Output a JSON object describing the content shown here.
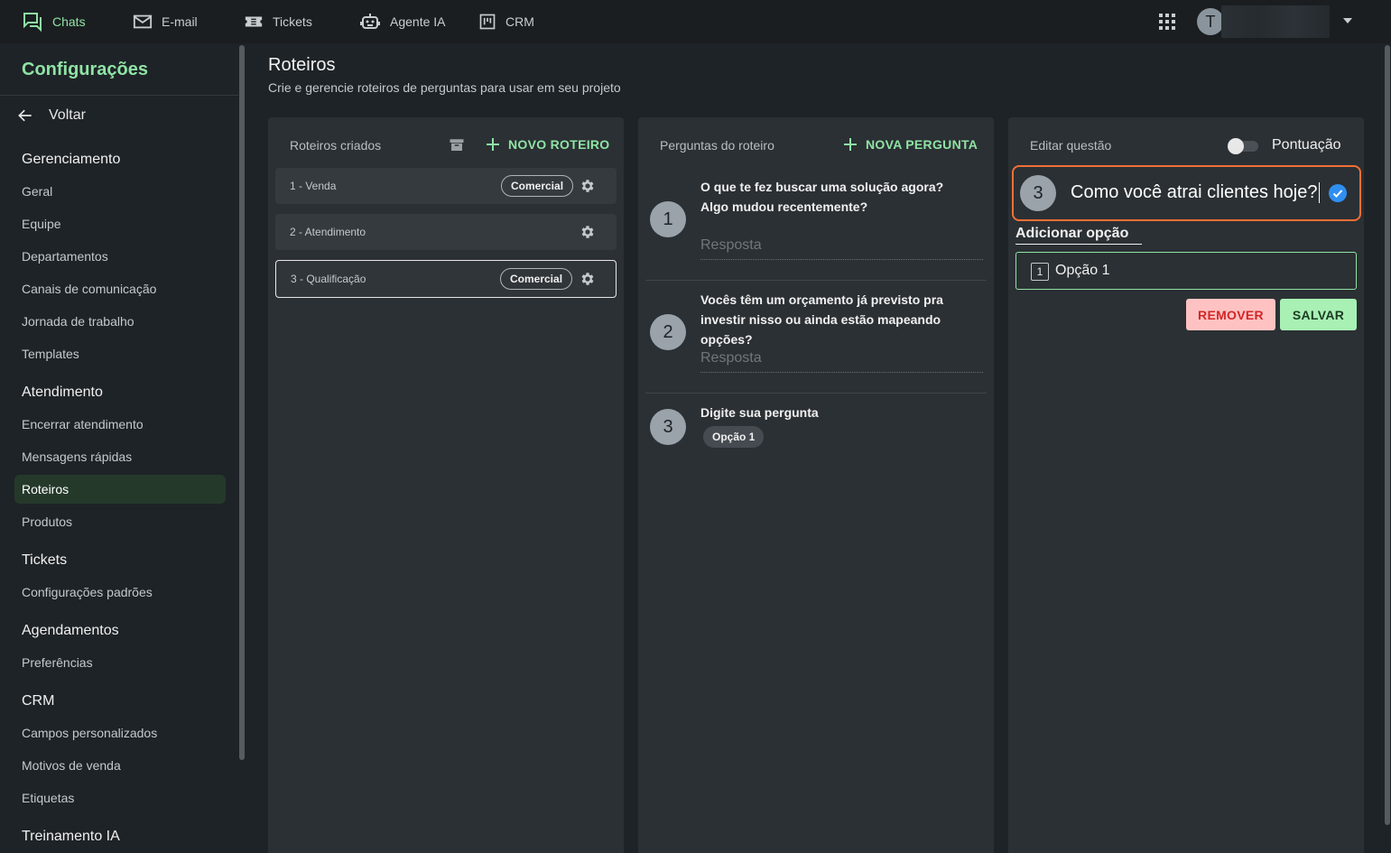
{
  "topnav": {
    "items": [
      {
        "label": "Chats",
        "icon": "chat-icon",
        "active": true
      },
      {
        "label": "E-mail",
        "icon": "mail-icon"
      },
      {
        "label": "Tickets",
        "icon": "ticket-icon"
      },
      {
        "label": "Agente IA",
        "icon": "robot-icon"
      },
      {
        "label": "CRM",
        "icon": "kanban-icon"
      }
    ],
    "avatar_initial": "T"
  },
  "sidebar": {
    "title": "Configurações",
    "back_label": "Voltar",
    "sections": [
      {
        "title": "Gerenciamento",
        "items": [
          "Geral",
          "Equipe",
          "Departamentos",
          "Canais de comunicação",
          "Jornada de trabalho",
          "Templates"
        ]
      },
      {
        "title": "Atendimento",
        "items": [
          "Encerrar atendimento",
          "Mensagens rápidas",
          "Roteiros",
          "Produtos"
        ]
      },
      {
        "title": "Tickets",
        "items": [
          "Configurações padrões"
        ]
      },
      {
        "title": "Agendamentos",
        "items": [
          "Preferências"
        ]
      },
      {
        "title": "CRM",
        "items": [
          "Campos personalizados",
          "Motivos de venda",
          "Etiquetas"
        ]
      },
      {
        "title": "Treinamento IA",
        "items": []
      }
    ],
    "active_item": "Roteiros"
  },
  "header": {
    "title": "Roteiros",
    "subtitle": "Crie e gerencie roteiros de perguntas para usar em seu projeto"
  },
  "scripts_panel": {
    "label": "Roteiros criados",
    "new_label": "NOVO ROTEIRO",
    "items": [
      {
        "name": "1 - Venda",
        "tag": "Comercial"
      },
      {
        "name": "2 - Atendimento",
        "tag": ""
      },
      {
        "name": "3 - Qualificação",
        "tag": "Comercial",
        "selected": true
      }
    ]
  },
  "questions_panel": {
    "label": "Perguntas do roteiro",
    "new_label": "NOVA PERGUNTA",
    "questions": [
      {
        "number": "1",
        "text": "O que te fez buscar uma solução agora? Algo mudou recentemente?",
        "answer_placeholder": "Resposta"
      },
      {
        "number": "2",
        "text": "Vocês têm um orçamento já previsto pra investir nisso ou ainda estão mapeando opções?",
        "answer_placeholder": "Resposta"
      },
      {
        "number": "3",
        "text": "Digite sua pergunta",
        "option": "Opção 1"
      }
    ]
  },
  "edit_panel": {
    "label": "Editar questão",
    "toggle_label": "Pontuação",
    "toggle_on": false,
    "question_number": "3",
    "question_text": "Como você atrai clientes hoje?",
    "add_option_label": "Adicionar opção",
    "options": [
      {
        "number": "1",
        "text": "Opção 1"
      }
    ],
    "remove_label": "REMOVER",
    "save_label": "SALVAR"
  },
  "colors": {
    "accent": "#8fe3a4",
    "focus_border": "#f07036",
    "remove_bg": "#ffc2c2",
    "save_bg": "#a8f0b4"
  }
}
